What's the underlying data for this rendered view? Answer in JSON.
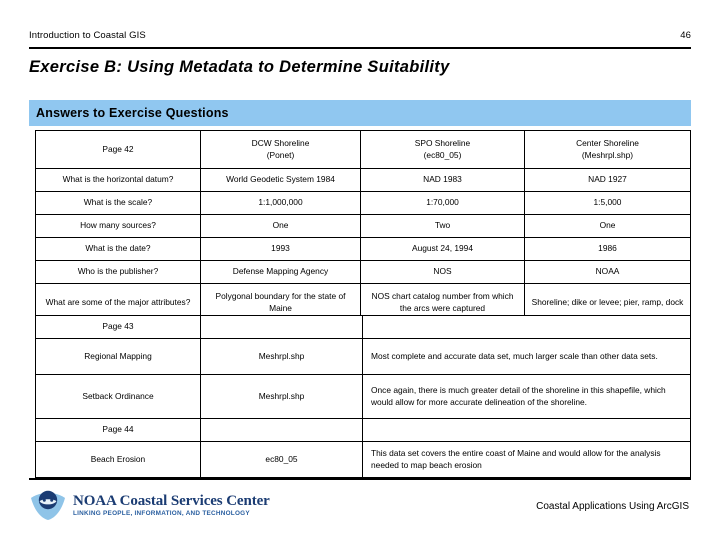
{
  "header": {
    "course_title": "Introduction to Coastal GIS",
    "page_number": "46"
  },
  "slide_title": "Exercise B: Using Metadata to Determine Suitability",
  "banner": {
    "label": "Answers to Exercise Questions",
    "color": "#90C7F0"
  },
  "answers_table": {
    "columns": [
      "Page 42",
      "DCW Shoreline\n(Ponet)",
      "SPO Shoreline\n(ec80_05)",
      "Center Shoreline\n(Meshrpl.shp)"
    ],
    "header": {
      "col0": "Page 42",
      "col1_line1": "DCW Shoreline",
      "col1_line2": "(Ponet)",
      "col2_line1": "SPO Shoreline",
      "col2_line2": "(ec80_05)",
      "col3_line1": "Center Shoreline",
      "col3_line2": "(Meshrpl.shp)"
    },
    "rows": [
      {
        "question": "What is the horizontal datum?",
        "dcw": "World Geodetic System 1984",
        "spo": "NAD 1983",
        "center": "NAD 1927"
      },
      {
        "question": "What is the scale?",
        "dcw": "1:1,000,000",
        "spo": "1:70,000",
        "center": "1:5,000"
      },
      {
        "question": "How many sources?",
        "dcw": "One",
        "spo": "Two",
        "center": "One"
      },
      {
        "question": "What is the date?",
        "dcw": "1993",
        "spo": "August 24, 1994",
        "center": "1986"
      },
      {
        "question": "Who is the publisher?",
        "dcw": "Defense Mapping Agency",
        "spo": "NOS",
        "center": "NOAA"
      },
      {
        "question": "What are some of the major attributes?",
        "dcw": "Polygonal boundary for the state of Maine",
        "spo": "NOS chart catalog number from which the arcs were captured",
        "center": "Shoreline; dike or levee; pier, ramp, dock"
      }
    ]
  },
  "pages_table": {
    "section_43": "Page 43",
    "section_44": "Page 44",
    "blank": "",
    "rows": [
      {
        "task": "Regional Mapping",
        "dataset": "Meshrpl.shp",
        "rationale": "Most complete and accurate data set, much larger scale than other data sets."
      },
      {
        "task": "Setback Ordinance",
        "dataset": "Meshrpl.shp",
        "rationale": "Once again, there is much greater detail of the shoreline in this shapefile, which would allow for more accurate delineation of the shoreline."
      },
      {
        "task": "Beach Erosion",
        "dataset": "ec80_05",
        "rationale": "This data set covers the entire coast of Maine and would allow for the analysis needed to map beach erosion"
      }
    ]
  },
  "footer": {
    "logo_title": "NOAA Coastal Services Center",
    "logo_tagline": "LINKING PEOPLE, INFORMATION, AND TECHNOLOGY",
    "right_text": "Coastal Applications Using ArcGIS",
    "logo_color_dark": "#1B3C73",
    "logo_color_light": "#8FC4E8"
  }
}
